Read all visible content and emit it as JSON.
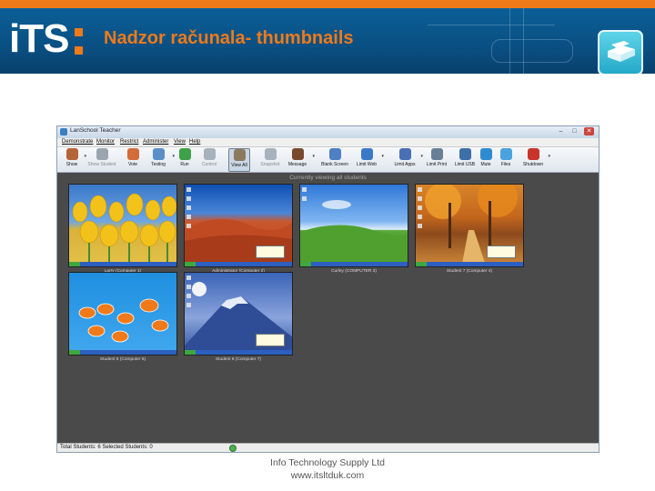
{
  "slide": {
    "logo_text": "iTS",
    "title": "Nadzor računala- thumbnails",
    "footer_line1": "Info Technology Supply Ltd",
    "footer_line2": "www.itsltduk.com"
  },
  "window": {
    "title": "LanSchool Teacher",
    "controls": {
      "minimize": "–",
      "maximize": "□",
      "close": "✕"
    },
    "menu": [
      "Demonstrate",
      "Monitor",
      "Restrict",
      "Administer",
      "View",
      "Help"
    ],
    "toolbar": [
      {
        "label": "Show",
        "icon": "person-show-icon",
        "color": "#b5643a",
        "dropdown": true,
        "disabled": false
      },
      {
        "label": "Show Student",
        "icon": "show-student-icon",
        "color": "#9aa5b0",
        "dropdown": false,
        "disabled": true
      },
      {
        "label": "Vote",
        "icon": "vote-icon",
        "color": "#d36b3a",
        "dropdown": false,
        "disabled": false
      },
      {
        "label": "Testing",
        "icon": "testing-icon",
        "color": "#5b8fc7",
        "dropdown": true,
        "disabled": false
      },
      {
        "label": "Run",
        "icon": "run-icon",
        "color": "#3fa04a",
        "dropdown": false,
        "disabled": false
      },
      {
        "label": "Control",
        "icon": "control-icon",
        "color": "#a8b2bc",
        "dropdown": false,
        "disabled": true
      },
      {
        "label": "View All",
        "icon": "view-all-icon",
        "color": "#8c7a5f",
        "dropdown": false,
        "disabled": false,
        "active": true
      },
      {
        "label": "Snapshot",
        "icon": "snapshot-icon",
        "color": "#a8b2bc",
        "dropdown": false,
        "disabled": true
      },
      {
        "label": "Message",
        "icon": "message-icon",
        "color": "#7a4a2f",
        "dropdown": true,
        "disabled": false
      },
      {
        "label": "Blank Screen",
        "icon": "blank-screen-icon",
        "color": "#4f7fc4",
        "dropdown": false,
        "disabled": false
      },
      {
        "label": "Limit Web",
        "icon": "limit-web-icon",
        "color": "#3c78c8",
        "dropdown": true,
        "disabled": false
      },
      {
        "label": "Limit Apps",
        "icon": "limit-apps-icon",
        "color": "#4a6fb5",
        "dropdown": true,
        "disabled": false
      },
      {
        "label": "Limit Print",
        "icon": "limit-print-icon",
        "color": "#6a7f96",
        "dropdown": false,
        "disabled": false
      },
      {
        "label": "Limit USB",
        "icon": "limit-usb-icon",
        "color": "#3d6fa8",
        "dropdown": false,
        "disabled": false
      },
      {
        "label": "Mute",
        "icon": "mute-icon",
        "color": "#2e8bd0",
        "dropdown": false,
        "disabled": false
      },
      {
        "label": "Files",
        "icon": "files-icon",
        "color": "#4aa3df",
        "dropdown": false,
        "disabled": false
      },
      {
        "label": "Shutdown",
        "icon": "shutdown-icon",
        "color": "#c8342a",
        "dropdown": true,
        "disabled": false
      }
    ],
    "viewing_label": "Currently viewing all students",
    "students": [
      {
        "caption": "Larry (Computer 1)",
        "wallpaper": "tulips"
      },
      {
        "caption": "Administrator (Computer 2)",
        "wallpaper": "desert"
      },
      {
        "caption": "Curley (COMPUTER 3)",
        "wallpaper": "bliss"
      },
      {
        "caption": "Student 7 (Computer 4)",
        "wallpaper": "autumn"
      },
      {
        "caption": "Student 5 (Computer 6)",
        "wallpaper": "fish"
      },
      {
        "caption": "Student 6 (Computer 7)",
        "wallpaper": "mountain"
      }
    ],
    "status": "Total Students: 6   Selected Students: 0"
  },
  "colors": {
    "accent_orange": "#f07a1a",
    "header_blue": "#0a4f82"
  }
}
